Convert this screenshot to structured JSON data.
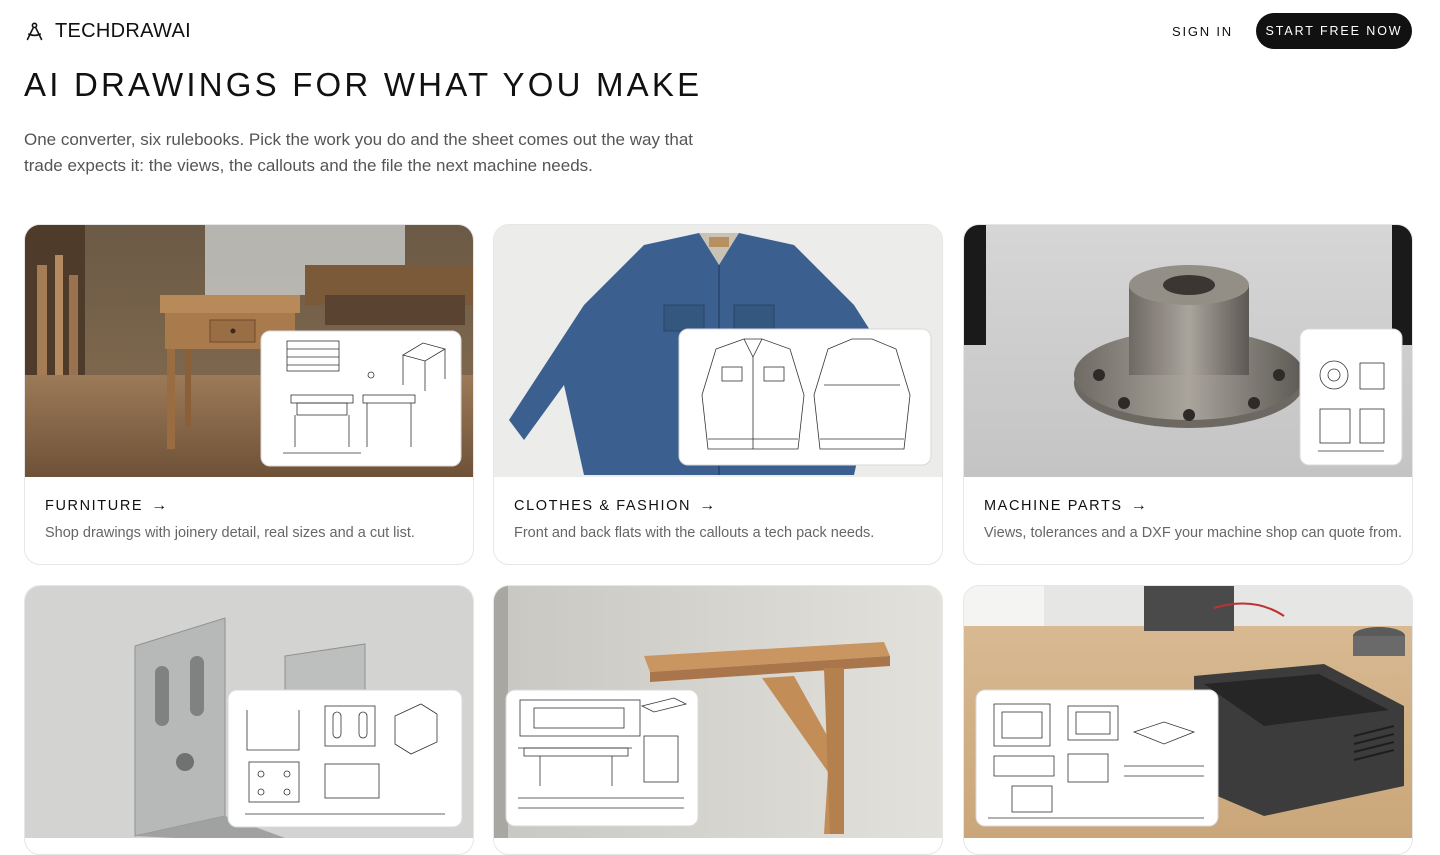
{
  "header": {
    "brand": "TECHDRAWAI",
    "brand_icon": "compass-icon",
    "sign_in": "SIGN IN",
    "cta": "START FREE NOW"
  },
  "hero": {
    "title": "AI DRAWINGS FOR WHAT YOU MAKE",
    "intro": "One converter, six rulebooks. Pick the work you do and the sheet comes out the way that trade expects it: the views, the callouts and the file the next machine needs."
  },
  "cards": [
    {
      "title": "FURNITURE",
      "arrow": "→",
      "description": "Shop drawings with joinery detail, real sizes and a cut list."
    },
    {
      "title": "CLOTHES & FASHION",
      "arrow": "→",
      "description": "Front and back flats with the callouts a tech pack needs."
    },
    {
      "title": "MACHINE PARTS",
      "arrow": "→",
      "description": "Views, tolerances and a DXF your machine shop can quote from."
    },
    {
      "title": "",
      "arrow": "",
      "description": ""
    },
    {
      "title": "",
      "arrow": "",
      "description": ""
    },
    {
      "title": "",
      "arrow": "",
      "description": ""
    }
  ],
  "colors": {
    "cta_bg": "#111111",
    "text": "#111111",
    "muted": "#666666",
    "border": "#e6e6e6"
  }
}
